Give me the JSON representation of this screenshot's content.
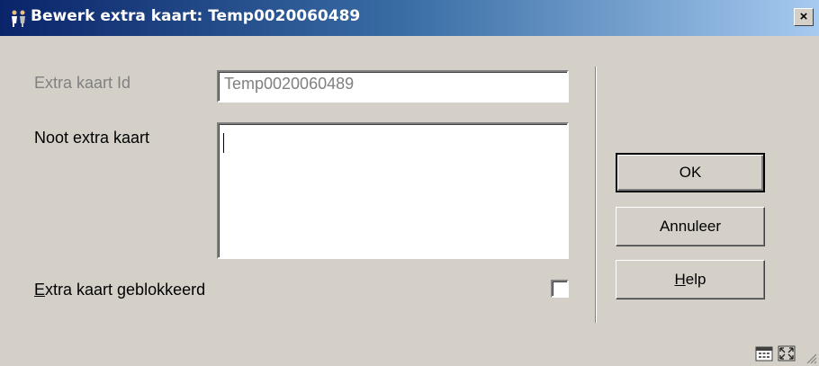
{
  "window": {
    "title": "Bewerk extra kaart: Temp0020060489",
    "close_label": "×"
  },
  "form": {
    "id_label": "Extra kaart Id",
    "id_value": "Temp0020060489",
    "note_label": "Noot extra kaart",
    "note_value": "",
    "blocked_label_accel": "E",
    "blocked_label_rest": "xtra kaart geblokkeerd",
    "blocked_checked": false
  },
  "buttons": {
    "ok": "OK",
    "cancel": "Annuleer",
    "help_accel": "H",
    "help_rest": "elp"
  },
  "status_icons": [
    "calendar-icon",
    "maximize-icon"
  ],
  "colors": {
    "titlebar_start": "#0a246a",
    "titlebar_end": "#a6caf0",
    "face": "#d4d0c8"
  }
}
